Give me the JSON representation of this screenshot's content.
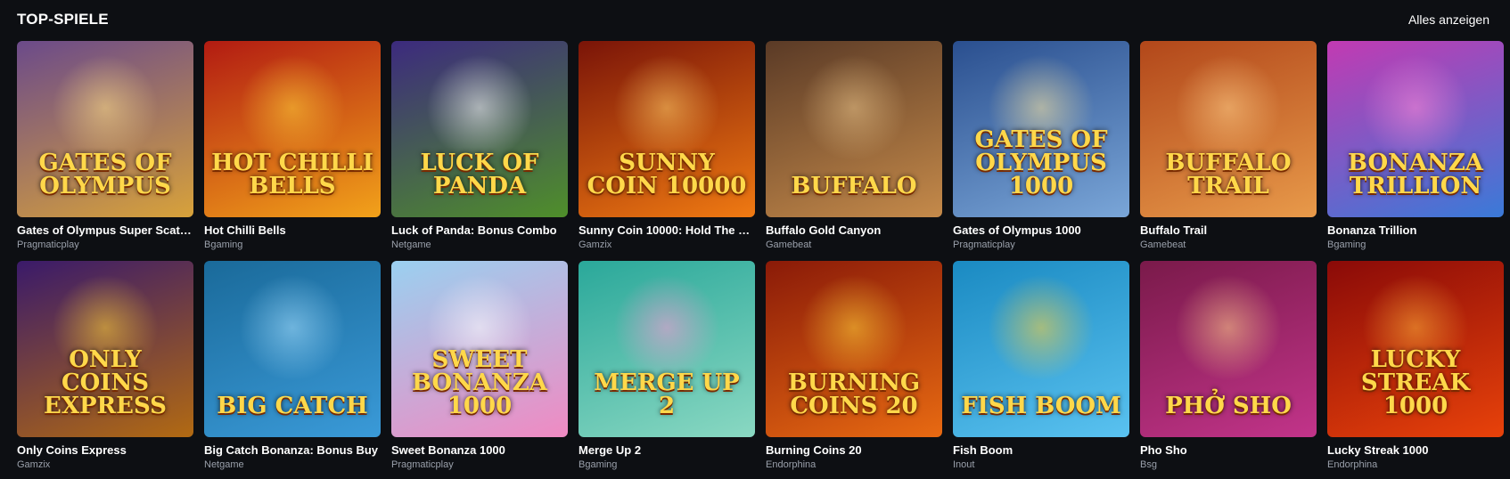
{
  "section": {
    "title": "TOP-SPIELE",
    "show_all_label": "Alles anzeigen"
  },
  "games": [
    {
      "name": "Gates of Olympus Super Scatter",
      "provider": "Pragmaticplay",
      "art": "Gates of Olympus",
      "bg": "#6b4a8a",
      "bg2": "#d8a23a",
      "glow": "#ffe08a"
    },
    {
      "name": "Hot Chilli Bells",
      "provider": "Bgaming",
      "art": "Hot Chilli Bells",
      "bg": "#b21b12",
      "bg2": "#f2a21a",
      "glow": "#ffd23a"
    },
    {
      "name": "Luck of Panda: Bonus Combo",
      "provider": "Netgame",
      "art": "Luck of Panda",
      "bg": "#3c2a7e",
      "bg2": "#4f8f2a",
      "glow": "#ffffff"
    },
    {
      "name": "Sunny Coin 10000: Hold The S…",
      "provider": "Gamzix",
      "art": "Sunny Coin 10000",
      "bg": "#7a1408",
      "bg2": "#f07a12",
      "glow": "#ffcf6a"
    },
    {
      "name": "Buffalo Gold Canyon",
      "provider": "Gamebeat",
      "art": "Buffalo",
      "bg": "#5a3a26",
      "bg2": "#c58a4a",
      "glow": "#e9c48a"
    },
    {
      "name": "Gates of Olympus 1000",
      "provider": "Pragmaticplay",
      "art": "Gates of Olympus 1000",
      "bg": "#2a4f8f",
      "bg2": "#7aa6d8",
      "glow": "#ffe8a0"
    },
    {
      "name": "Buffalo Trail",
      "provider": "Gamebeat",
      "art": "Buffalo Trail",
      "bg": "#b2471a",
      "bg2": "#e89a4a",
      "glow": "#ffd08a"
    },
    {
      "name": "Bonanza Trillion",
      "provider": "Bgaming",
      "art": "Bonanza Trillion",
      "bg": "#c23ab2",
      "bg2": "#3a7ad8",
      "glow": "#ff8ad8"
    },
    {
      "name": "Only Coins Express",
      "provider": "Gamzix",
      "art": "Only Coins Express",
      "bg": "#3a1a6a",
      "bg2": "#b26a12",
      "glow": "#ffd23a"
    },
    {
      "name": "Big Catch Bonanza: Bonus Buy",
      "provider": "Netgame",
      "art": "Big Catch",
      "bg": "#1a6a9a",
      "bg2": "#3a9ad8",
      "glow": "#a8e0ff"
    },
    {
      "name": "Sweet Bonanza 1000",
      "provider": "Pragmaticplay",
      "art": "Sweet Bonanza 1000",
      "bg": "#9ad0f0",
      "bg2": "#f08ac2",
      "glow": "#ffffff"
    },
    {
      "name": "Merge Up 2",
      "provider": "Bgaming",
      "art": "Merge Up 2",
      "bg": "#2aa89a",
      "bg2": "#8ad8c2",
      "glow": "#ff9ad8"
    },
    {
      "name": "Burning Coins 20",
      "provider": "Endorphina",
      "art": "Burning Coins 20",
      "bg": "#8a1a08",
      "bg2": "#e86a12",
      "glow": "#ffd23a"
    },
    {
      "name": "Fish Boom",
      "provider": "Inout",
      "art": "Fish Boom",
      "bg": "#1a8ac2",
      "bg2": "#5ac2f0",
      "glow": "#ffd23a"
    },
    {
      "name": "Pho Sho",
      "provider": "Bsg",
      "art": "Phở Sho",
      "bg": "#7a1a4a",
      "bg2": "#c2348a",
      "glow": "#ffd08a"
    },
    {
      "name": "Lucky Streak 1000",
      "provider": "Endorphina",
      "art": "Lucky Streak 1000",
      "bg": "#8a0a08",
      "bg2": "#e8420a",
      "glow": "#ffb23a"
    }
  ]
}
